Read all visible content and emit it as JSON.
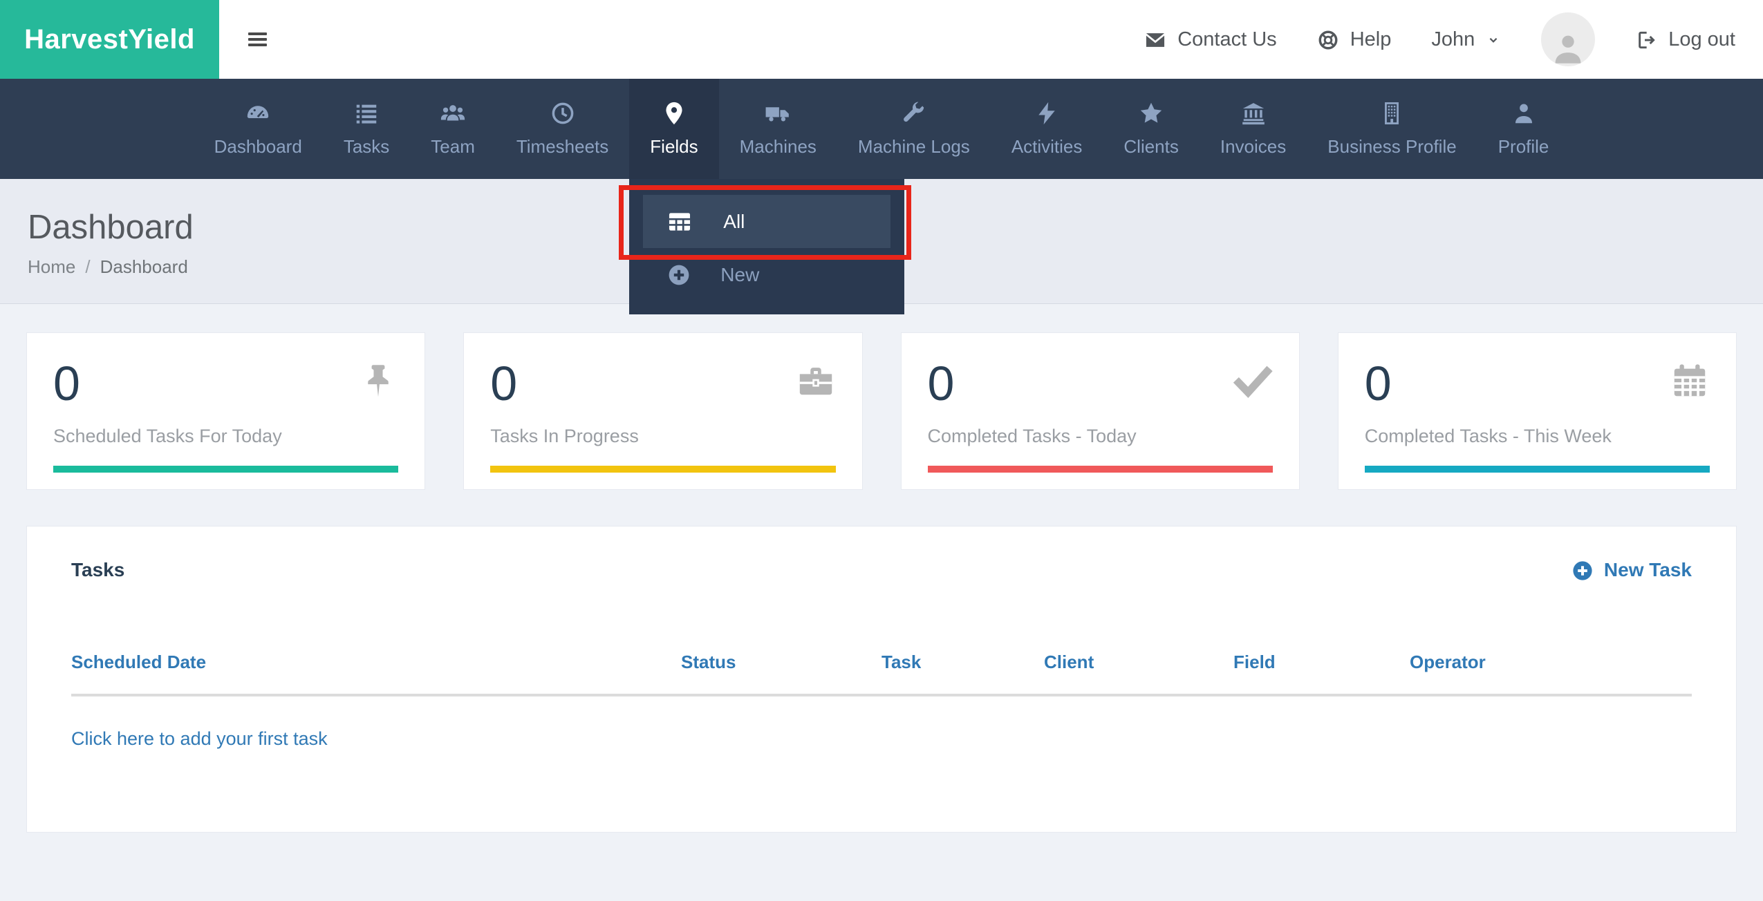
{
  "brand": {
    "name": "HarvestYield"
  },
  "header": {
    "contact_us": "Contact Us",
    "help": "Help",
    "user_name": "John",
    "logout": "Log out"
  },
  "nav": {
    "items": [
      {
        "label": "Dashboard",
        "icon": "gauge-icon"
      },
      {
        "label": "Tasks",
        "icon": "list-icon"
      },
      {
        "label": "Team",
        "icon": "users-icon"
      },
      {
        "label": "Timesheets",
        "icon": "clock-icon"
      },
      {
        "label": "Fields",
        "icon": "map-marker-icon",
        "active": true
      },
      {
        "label": "Machines",
        "icon": "truck-icon"
      },
      {
        "label": "Machine Logs",
        "icon": "wrench-icon"
      },
      {
        "label": "Activities",
        "icon": "bolt-icon"
      },
      {
        "label": "Clients",
        "icon": "star-icon"
      },
      {
        "label": "Invoices",
        "icon": "bank-icon"
      },
      {
        "label": "Business Profile",
        "icon": "building-icon"
      },
      {
        "label": "Profile",
        "icon": "user-icon"
      }
    ]
  },
  "fields_menu": {
    "items": [
      {
        "label": "All",
        "icon": "table-icon",
        "highlighted": true
      },
      {
        "label": "New",
        "icon": "plus-circle-icon"
      }
    ]
  },
  "page": {
    "title": "Dashboard",
    "breadcrumb": {
      "home": "Home",
      "separator": "/",
      "current": "Dashboard"
    }
  },
  "stats": [
    {
      "value": "0",
      "label": "Scheduled Tasks For Today",
      "icon": "pin-icon",
      "bar_color": "#1ABB9C"
    },
    {
      "value": "0",
      "label": "Tasks In Progress",
      "icon": "briefcase-icon",
      "bar_color": "#F2C40F"
    },
    {
      "value": "0",
      "label": "Completed Tasks - Today",
      "icon": "check-icon",
      "bar_color": "#F0595A"
    },
    {
      "value": "0",
      "label": "Completed Tasks - This Week",
      "icon": "calendar-icon",
      "bar_color": "#16A9C2"
    }
  ],
  "tasks_panel": {
    "title": "Tasks",
    "new_task": "New Task",
    "columns": [
      "Scheduled Date",
      "Status",
      "Task",
      "Client",
      "Field",
      "Operator"
    ],
    "empty_link": "Click here to add your first task"
  },
  "colors": {
    "brand_green": "#26B99A",
    "nav_bg": "#2F3E54",
    "nav_active_bg": "#28354A",
    "link_blue": "#3079B5",
    "annotation_red": "#E8251A"
  }
}
